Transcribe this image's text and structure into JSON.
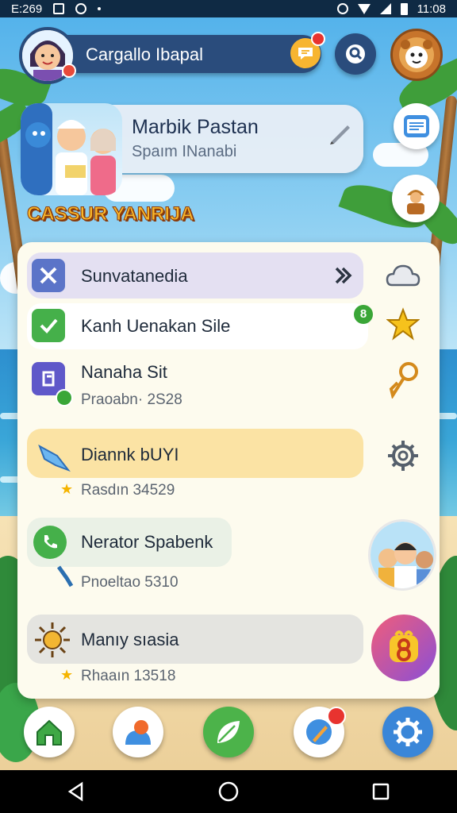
{
  "status_bar": {
    "time_left": "E:269",
    "time_right": "11:08"
  },
  "header": {
    "title": "Cargallo Ibapal"
  },
  "profile": {
    "name": "Marbik Pastan",
    "subtitle": "Spaım INanabi"
  },
  "section": {
    "title": "CASSUR YANRIJA"
  },
  "rows": [
    {
      "title": "Sunvatanedia",
      "subtitle": ""
    },
    {
      "title": "Kanh Uenakan Sile",
      "subtitle": "",
      "badge": "8"
    },
    {
      "title": "Nanaha Sit",
      "subtitle": "Praoabn· 2S28"
    },
    {
      "title": "Diannk bUYI",
      "subtitle": "Rasdın 34529"
    },
    {
      "title": "Nerator Spabenk",
      "subtitle": "Pnoeltao 5310"
    },
    {
      "title": "Manıy sıasia",
      "subtitle": "Rhaaın 13518"
    }
  ],
  "colors": {
    "header_blue": "#2a4c7c",
    "highlight_lavender": "#e4e0f2",
    "highlight_yellow": "#fbe3a4",
    "accent_green": "#3aa637",
    "accent_orange": "#f7b531"
  },
  "icons": {
    "chat": "chat-bubble-icon",
    "search": "search-icon",
    "mascot": "mascot-icon",
    "edit": "pen-icon",
    "notes": "notes-icon",
    "settings": "gear-icon",
    "home": "home-icon"
  }
}
